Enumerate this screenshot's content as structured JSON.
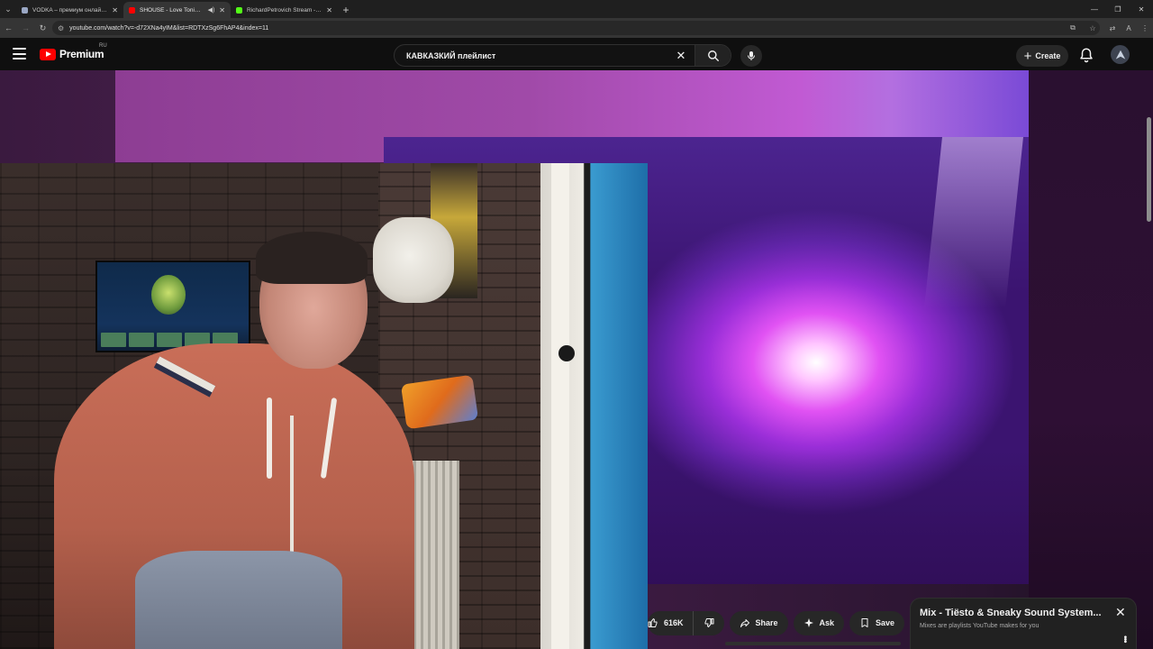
{
  "browser": {
    "tabs": [
      {
        "title": "VODKA – премиум онлайн-кази",
        "favicon_color": "#9aa7c4",
        "active": false,
        "audio": false
      },
      {
        "title": "SHOUSE - Love Tonight (O",
        "favicon_color": "#ff0000",
        "active": true,
        "audio": true
      },
      {
        "title": "RichardPetrovich Stream - Wat",
        "favicon_color": "#53fc18",
        "active": false,
        "audio": false
      }
    ],
    "url": "youtube.com/watch?v=-d72XNa4yIM&list=RDTXzSg6FhAP4&index=11"
  },
  "masthead": {
    "brand": "Premium",
    "region": "RU",
    "search_query": "КАВКАЗКИЙ плейлист",
    "create_label": "Create"
  },
  "actions": {
    "likes": "616K",
    "share": "Share",
    "ask": "Ask",
    "save": "Save"
  },
  "mix_panel": {
    "title": "Mix - Tiësto & Sneaky Sound System...",
    "subtitle": "Mixes are playlists YouTube makes for you"
  },
  "colors": {
    "accent": "#ff0000",
    "background": "#0f0f0f",
    "chip": "#272727"
  }
}
